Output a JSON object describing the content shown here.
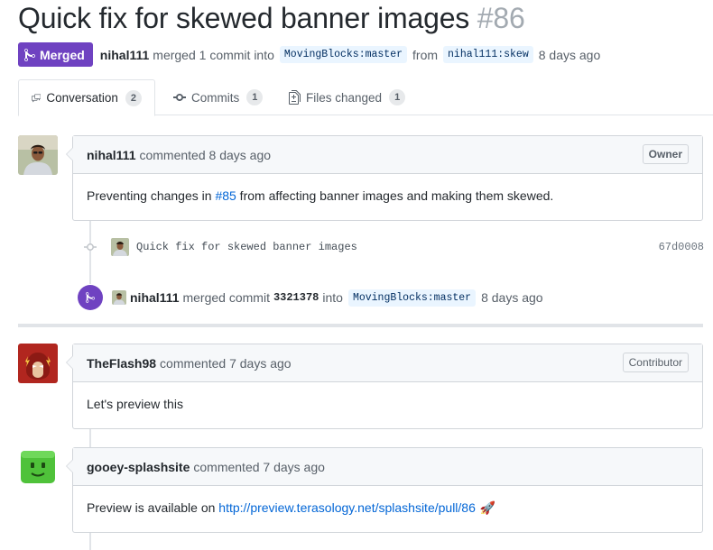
{
  "pr": {
    "title": "Quick fix for skewed banner images",
    "number": "#86",
    "state": "Merged",
    "author": "nihal111",
    "merge_text": "merged 1 commit into",
    "base_branch": "MovingBlocks:master",
    "from_text": "from",
    "head_branch": "nihal111:skew",
    "age": "8 days ago"
  },
  "tabs": [
    {
      "label": "Conversation",
      "count": "2",
      "icon": "comment-discussion-icon"
    },
    {
      "label": "Commits",
      "count": "1",
      "icon": "git-commit-icon"
    },
    {
      "label": "Files changed",
      "count": "1",
      "icon": "file-diff-icon"
    }
  ],
  "comments": [
    {
      "author": "nihal111",
      "action": "commented 8 days ago",
      "role": "Owner",
      "body_before": "Preventing changes in ",
      "body_link": "#85",
      "body_after": " from affecting banner images and making them skewed."
    },
    {
      "author": "TheFlash98",
      "action": "commented 7 days ago",
      "role": "Contributor",
      "body": "Let's preview this"
    },
    {
      "author": "gooey-splashsite",
      "action": "commented 7 days ago",
      "body_before": "Preview is available on ",
      "body_link": "http://preview.terasology.net/splashsite/pull/86",
      "body_emoji": "🚀"
    }
  ],
  "commit": {
    "message": "Quick fix for skewed banner images",
    "sha": "67d0008"
  },
  "merge_event": {
    "author": "nihal111",
    "text1": "merged commit",
    "sha": "3321378",
    "text2": "into",
    "branch": "MovingBlocks:master",
    "age": "8 days ago"
  },
  "colors": {
    "merged": "#6f42c1",
    "link": "#0366d6",
    "branch_bg": "#eaf5ff"
  }
}
